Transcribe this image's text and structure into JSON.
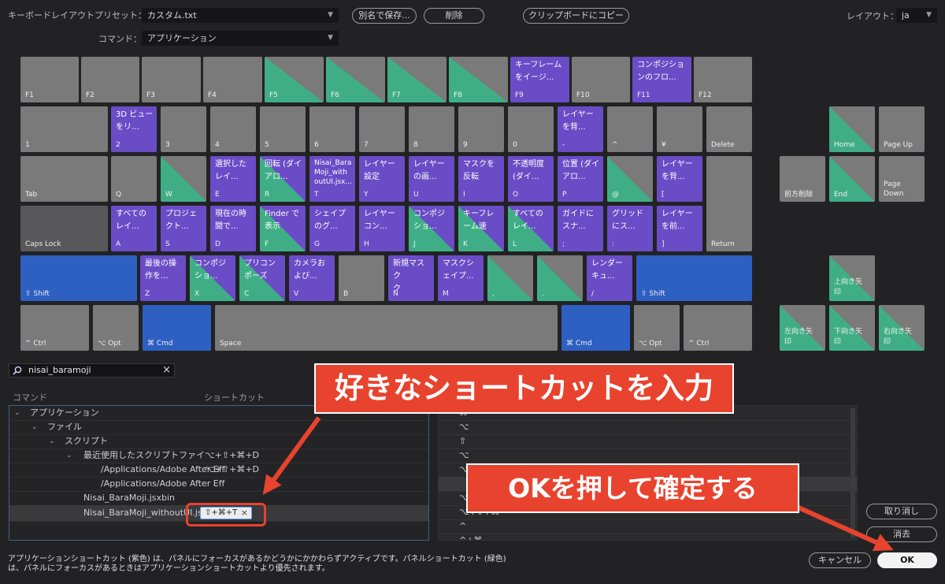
{
  "header": {
    "preset_label": "キーボードレイアウトプリセット：",
    "preset_value": "カスタム.txt",
    "save_as": "別名で保存...",
    "delete": "削除",
    "copy_clipboard": "クリップボードにコピー",
    "layout_label": "レイアウト：",
    "layout_value": "ja",
    "command_label": "コマンド：",
    "command_value": "アプリケーション"
  },
  "keys": {
    "f1": "F1",
    "f2": "F2",
    "f3": "F3",
    "f4": "F4",
    "f5": "F5",
    "f6": "F6",
    "f7": "F7",
    "f8": "F8",
    "f9": "F9",
    "f9_cmd": "キーフレーム\nをイージ...",
    "f10": "F10",
    "f11": "F11",
    "f11_cmd": "コンポジショ\nンのフロ...",
    "f12": "F12",
    "k1": "1",
    "k2": "2",
    "k2_cmd": "3D ビュー\nをリ...",
    "k3": "3",
    "k4": "4",
    "k5": "5",
    "k6": "6",
    "k7": "7",
    "k8": "8",
    "k9": "9",
    "k0": "0",
    "minus": "-",
    "minus_cmd": "レイヤー\nを背...",
    "caret": "^",
    "yen": "¥",
    "delete_key": "Delete",
    "tab": "Tab",
    "q": "Q",
    "w": "W",
    "e": "E",
    "e_cmd": "選択した\nレイ...",
    "r": "R",
    "r_cmd": "回転 (ダイ\nアロ...",
    "t": "T",
    "t_cmd": "Nisai_Bara\nMoji_with\noutUI.jsx...",
    "y": "Y",
    "y_cmd": "レイヤー\n設定",
    "u": "U",
    "u_cmd": "レイヤー\nの画...",
    "i": "I",
    "i_cmd": "マスクを\n反転",
    "o": "O",
    "o_cmd": "不透明度\n(ダイ...",
    "p": "P",
    "p_cmd": "位置 (ダイ\nアロ...",
    "at": "@",
    "lbracket": "[",
    "lbracket_cmd": "レイヤー\nを背...",
    "capslock": "Caps Lock",
    "a": "A",
    "a_cmd": "すべての\nレイ...",
    "s": "S",
    "s_cmd": "プロジェ\nクト...",
    "d": "D",
    "d_cmd": "現在の時\n間で...",
    "f": "F",
    "f_cmd": "Finder で\n表示",
    "g": "G",
    "g_cmd": "シェイプ\nのグ...",
    "h": "H",
    "h_cmd": "レイヤー\nコン...",
    "j": "J",
    "j_cmd": "コンポジ\nショ...",
    "k": "K",
    "k_cmd": "キーフレ\nーム速",
    "l": "L",
    "l_cmd": "すべての\nレイ...",
    "semicolon": ";",
    "semicolon_cmd": "ガイドに\nスナ...",
    "colon": ":",
    "colon_cmd": "グリッド\nにス...",
    "rbracket": "]",
    "rbracket_cmd": "レイヤー\nを前...",
    "return": "Return",
    "lshift": "⇧ Shift",
    "z": "Z",
    "z_cmd": "最後の操\n作を...",
    "x": "X",
    "x_cmd": "コンポジ\nショ...",
    "c": "C",
    "c_cmd": "プリコン\nポーズ",
    "v": "V",
    "v_cmd": "カメラお\nよび...",
    "b": "B",
    "n": "N",
    "n_cmd": "新規マスク\nク",
    "m": "M",
    "m_cmd": "マスクシ\nェイプ...",
    "comma": ",",
    "period": ".",
    "slash": "/",
    "slash_cmd": "レンダー\nキュ...",
    "rshift": "⇧ Shift",
    "lctrl": "^ Ctrl",
    "lopt": "⌥ Opt",
    "lcmd": "⌘ Cmd",
    "space": "Space",
    "rcmd": "⌘ Cmd",
    "ropt": "⌥ Opt",
    "rctrl": "^ Ctrl",
    "home": "Home",
    "pageup": "Page Up",
    "fwd_delete": "前方削除",
    "end": "End",
    "pagedown": "Page\nDown",
    "up": "上向き矢\n印",
    "left": "左向き矢\n印",
    "down": "下向き矢\n印",
    "right": "右向き矢\n印"
  },
  "search": {
    "value": "nisai_baramoji",
    "clear": "×"
  },
  "columns": {
    "command": "コマンド",
    "shortcut": "ショートカット"
  },
  "tree": [
    {
      "label": "アプリケーション"
    },
    {
      "label": "ファイル"
    },
    {
      "label": "スクリプト"
    },
    {
      "label": "最近使用したスクリプトファイ",
      "shortcut": "⌥+⇧+⌘+D"
    },
    {
      "label": "/Applications/Adobe After Eff",
      "shortcut": "⌥+⇧+⌘+D"
    },
    {
      "label": "/Applications/Adobe After Eff"
    },
    {
      "label": "Nisai_BaraMoji.jsxbin"
    },
    {
      "label": "Nisai_BaraMoji_withoutUI.jsxbin",
      "shortcut": "⇧+⌘+T",
      "clear": "×"
    }
  ],
  "right_panel": [
    "⌘",
    "⌥",
    "⇧",
    "⌥",
    "⌥",
    "",
    "⌥",
    "⌥+⇧+⌘",
    "^",
    "^+⌘"
  ],
  "buttons": {
    "undo": "取り消し",
    "clear": "消去",
    "cancel": "キャンセル",
    "ok": "OK"
  },
  "footer": {
    "line1": "アプリケーションショートカット (紫色) は、パネルにフォーカスがあるかどうかにかかわらずアクティブです。パネルショートカット (緑色)",
    "line2": "は、パネルにフォーカスがあるときはアプリケーションショートカットより優先されます。"
  },
  "annotations": {
    "callout1": "好きなショートカットを入力",
    "callout2": "OKを押して確定する"
  },
  "colors": {
    "app_shortcut": "#6a4cc7",
    "panel_shortcut": "#3fae86",
    "modifier": "#2e5fc2",
    "annotation": "#e8432e"
  }
}
